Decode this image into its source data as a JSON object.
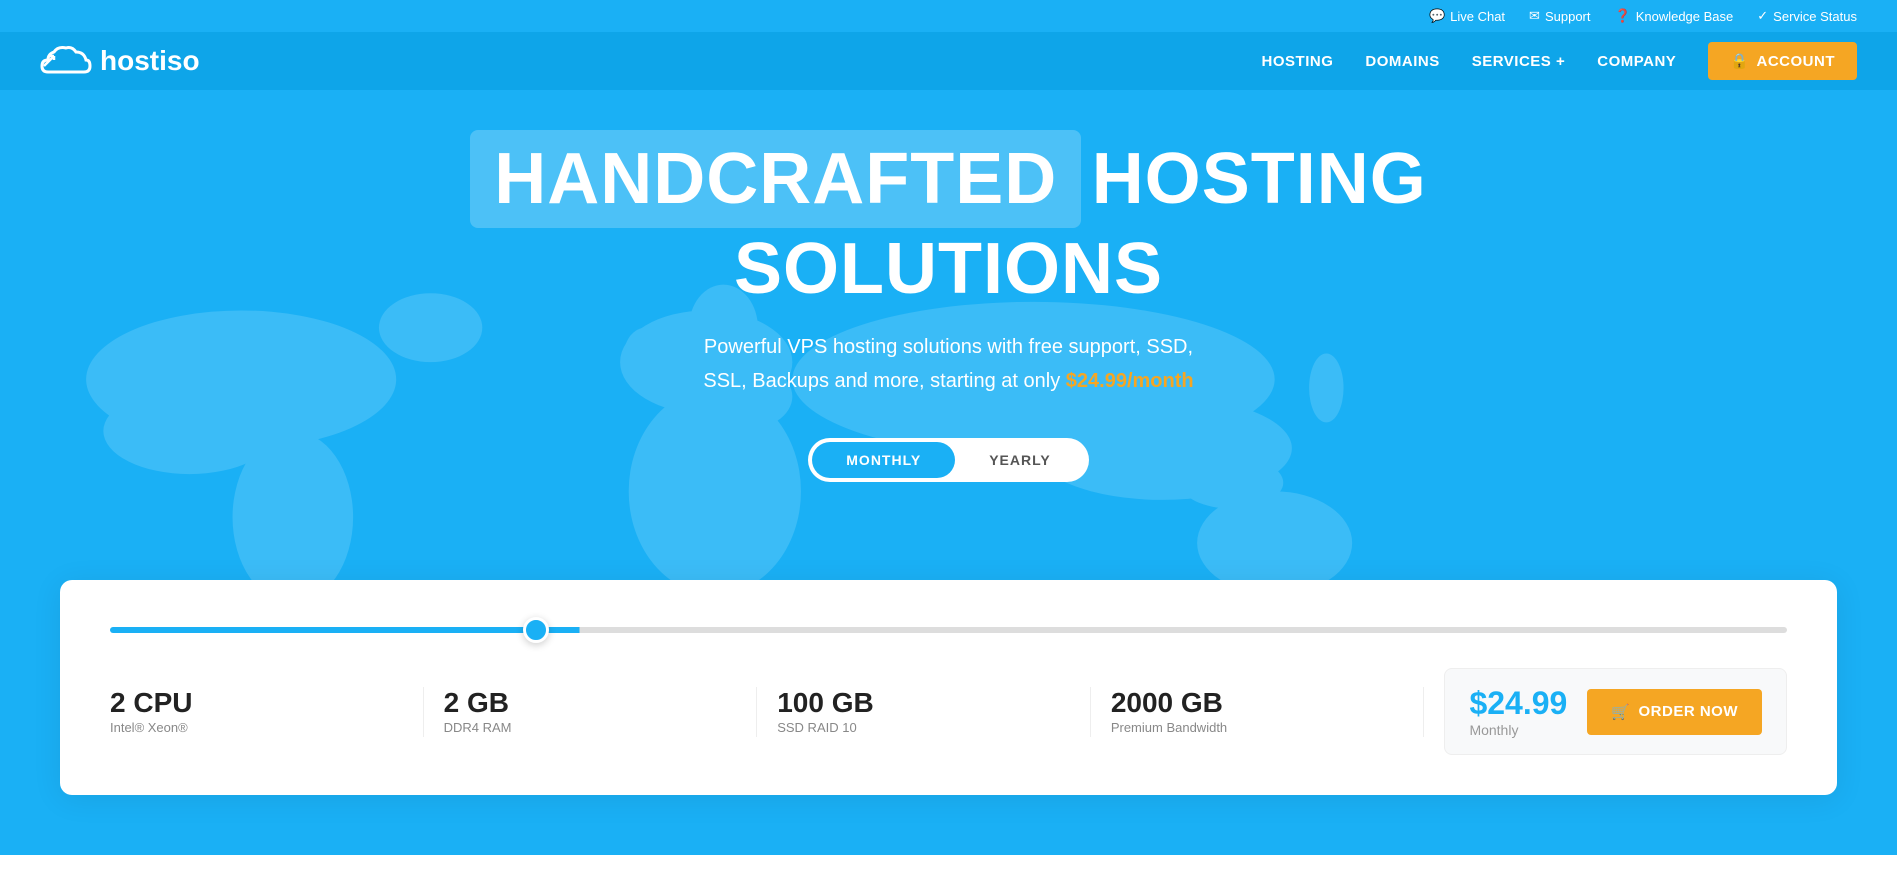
{
  "topbar": {
    "items": [
      {
        "id": "live-chat",
        "icon": "💬",
        "label": "Live Chat"
      },
      {
        "id": "support",
        "icon": "✉",
        "label": "Support"
      },
      {
        "id": "knowledge-base",
        "icon": "❓",
        "label": "Knowledge Base"
      },
      {
        "id": "service-status",
        "icon": "✓",
        "label": "Service Status"
      }
    ]
  },
  "navbar": {
    "logo_text": "hostiso",
    "links": [
      {
        "id": "hosting",
        "label": "HOSTING"
      },
      {
        "id": "domains",
        "label": "DOMAINS"
      },
      {
        "id": "services",
        "label": "SERVICES",
        "has_plus": true
      },
      {
        "id": "company",
        "label": "COMPANY"
      }
    ],
    "account_btn": "ACCOUNT"
  },
  "hero": {
    "title_highlight": "HANDCRAFTED",
    "title_rest": "HOSTING SOLUTIONS",
    "subtitle_1": "Powerful VPS hosting solutions with free support, SSD,",
    "subtitle_2": "SSL, Backups and more, starting at only ",
    "price_highlight": "$24.99/month",
    "toggle": {
      "monthly": "MONTHLY",
      "yearly": "YEARLY",
      "active": "monthly"
    }
  },
  "pricing": {
    "slider_value": 25,
    "specs": [
      {
        "id": "cpu",
        "value": "2 CPU",
        "label": "Intel® Xeon®"
      },
      {
        "id": "ram",
        "value": "2 GB",
        "label": "DDR4 RAM"
      },
      {
        "id": "storage",
        "value": "100 GB",
        "label": "SSD RAID 10"
      },
      {
        "id": "bandwidth",
        "value": "2000 GB",
        "label": "Premium Bandwidth"
      }
    ],
    "price": "$24.99",
    "period": "Monthly",
    "order_btn": "ORDER NOW"
  },
  "icons": {
    "chat": "💬",
    "support": "✉",
    "knowledge": "❓",
    "status": "✓",
    "lock": "🔒",
    "cart": "🛒"
  }
}
